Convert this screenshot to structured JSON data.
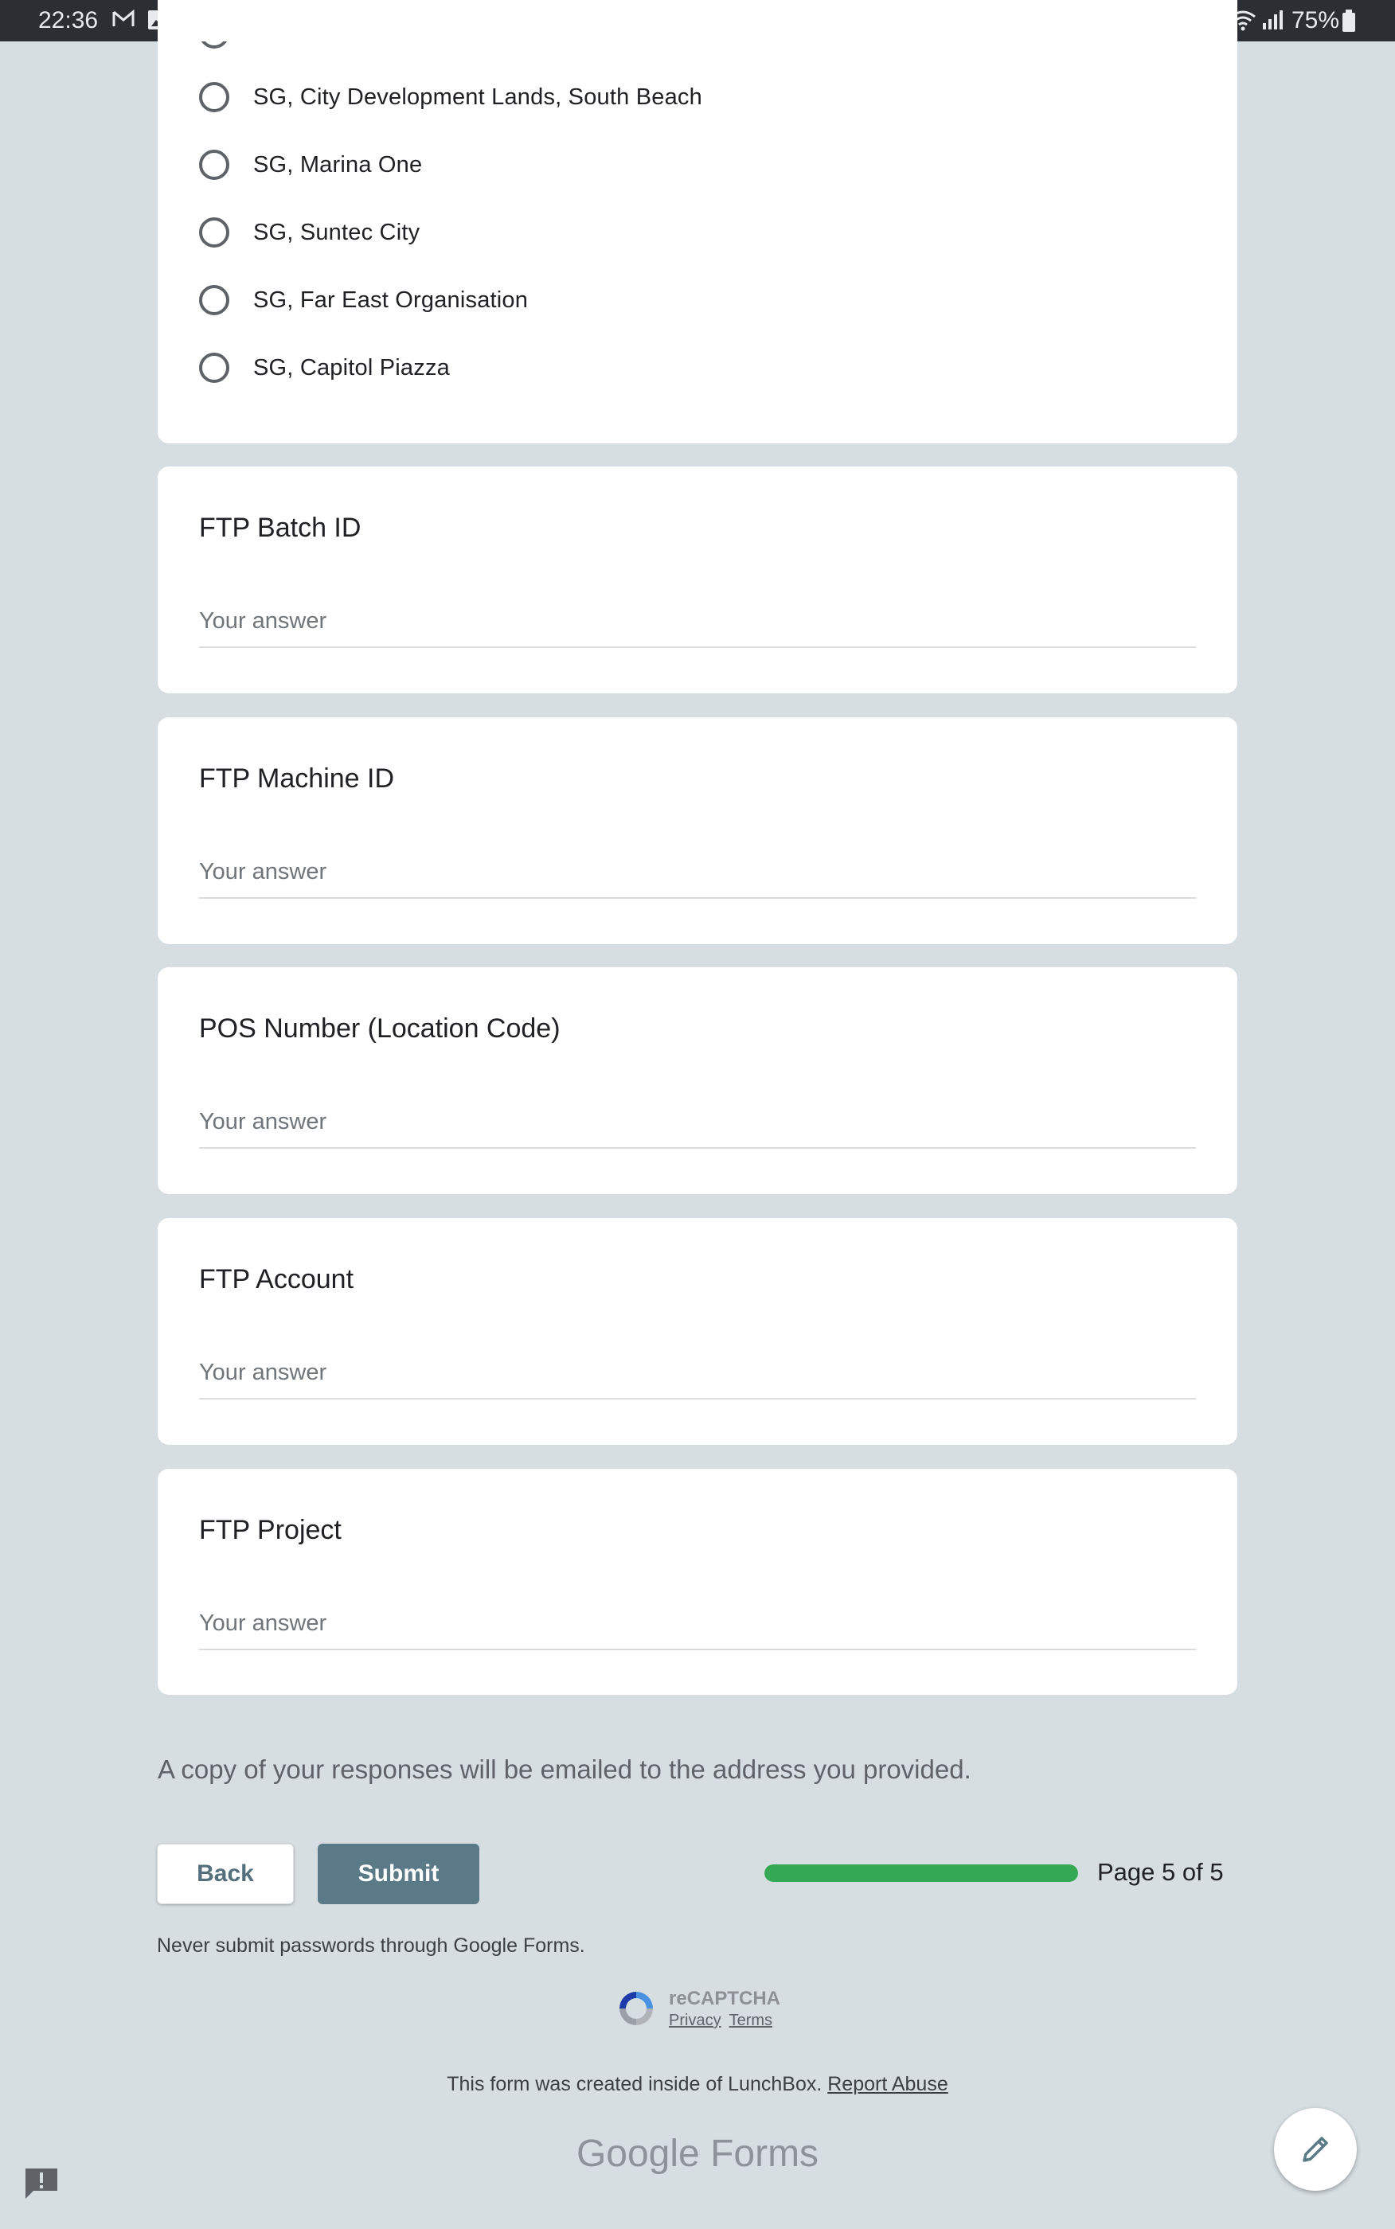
{
  "status_bar": {
    "time": "22:36",
    "battery_text": "75%"
  },
  "radio_question": {
    "options": [
      "SG, City Development Lands, South Beach",
      "SG, Marina One",
      "SG, Suntec City",
      "SG, Far East Organisation",
      "SG, Capitol Piazza"
    ]
  },
  "questions": [
    {
      "title": "FTP Batch ID",
      "placeholder": "Your answer"
    },
    {
      "title": "FTP Machine ID",
      "placeholder": "Your answer"
    },
    {
      "title": "POS Number (Location Code)",
      "placeholder": "Your answer"
    },
    {
      "title": "FTP Account",
      "placeholder": "Your answer"
    },
    {
      "title": "FTP Project",
      "placeholder": "Your answer"
    }
  ],
  "footer": {
    "copy_note": "A copy of your responses will be emailed to the address you provided.",
    "back_label": "Back",
    "submit_label": "Submit",
    "progress_fraction": 1.0,
    "page_text": "Page 5 of 5",
    "password_note": "Never submit passwords through Google Forms.",
    "recaptcha_title": "reCAPTCHA",
    "recaptcha_privacy": "Privacy",
    "recaptcha_terms": "Terms",
    "created_text": "This form was created inside of LunchBox.",
    "report_abuse": "Report Abuse",
    "brand_google": "Google",
    "brand_forms": "Forms"
  },
  "colors": {
    "background": "#d6dee2",
    "accent": "#5a7a88",
    "progress": "#34a853"
  },
  "icons": [
    "gmail-icon",
    "gallery-icon",
    "wifi-icon",
    "signal-icon",
    "battery-icon",
    "recaptcha-icon",
    "edit-pencil-icon",
    "feedback-icon"
  ]
}
